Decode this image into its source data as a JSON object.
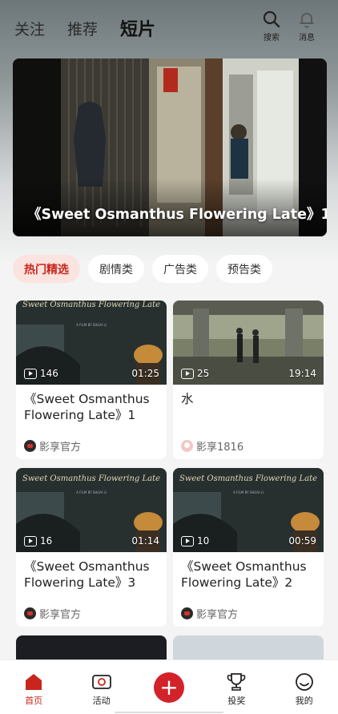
{
  "header": {
    "tabs": [
      {
        "label": "关注"
      },
      {
        "label": "推荐"
      },
      {
        "label": "短片"
      }
    ],
    "search_label": "搜索",
    "messages_label": "消息"
  },
  "banner": {
    "title": "《Sweet Osmanthus Flowering Late》1"
  },
  "categories": [
    {
      "label": "热门精选",
      "active": true
    },
    {
      "label": "剧情类"
    },
    {
      "label": "广告类"
    },
    {
      "label": "预告类"
    }
  ],
  "videos": [
    {
      "title": "《Sweet Osmanthus Flowering Late》1",
      "plays": "146",
      "duration": "01:25",
      "author": "影享官方",
      "thumb_text": "Sweet Osmanthus Flowering Late",
      "thumb_sub": "A FILM BY SHUAI LI"
    },
    {
      "title": "水",
      "plays": "25",
      "duration": "19:14",
      "author": "影享1816"
    },
    {
      "title": "《Sweet Osmanthus Flowering Late》3",
      "plays": "16",
      "duration": "01:14",
      "author": "影享官方",
      "thumb_text": "Sweet Osmanthus Flowering Late",
      "thumb_sub": "A FILM BY SHUAI LI"
    },
    {
      "title": "《Sweet Osmanthus Flowering Late》2",
      "plays": "10",
      "duration": "00:59",
      "author": "影享官方",
      "thumb_text": "Sweet Osmanthus Flowering Late",
      "thumb_sub": "A FILM BY SHUAI LI"
    }
  ],
  "bottom_nav": {
    "home": "首页",
    "activity": "活动",
    "add": "+",
    "awards": "投奖",
    "mine": "我的"
  },
  "colors": {
    "accent": "#c8261c",
    "chip_active_bg": "#fbe3df"
  }
}
